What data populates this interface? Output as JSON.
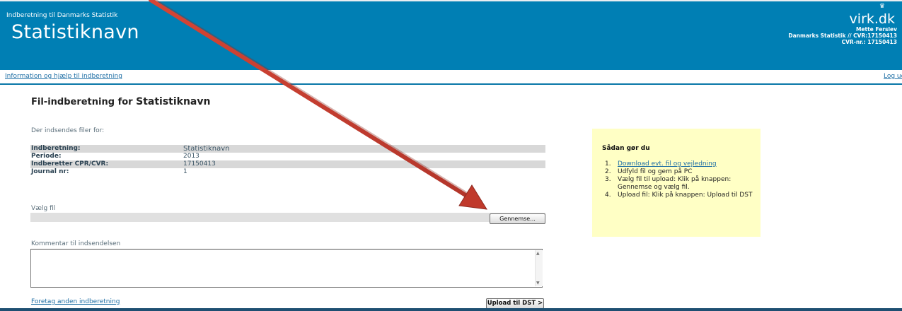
{
  "header": {
    "subtitle": "Indberetning til Danmarks Statistik",
    "title": "Statistiknavn",
    "logo": "virk.dk",
    "user_name": "Mette Ferslev",
    "user_org": "Danmarks Statistik // CVR:17150413",
    "user_cvr": "CVR-nr.: 17150413"
  },
  "nav": {
    "help_link": "Information og hjælp til indberetning",
    "logout_link": "Log ud"
  },
  "page": {
    "title_prefix": "Fil-indberetning for",
    "title_name": "Statistiknavn",
    "intro": "Der indsendes filer for:"
  },
  "info_rows": [
    {
      "label": "Indberetning:",
      "value": "Statistiknavn"
    },
    {
      "label": "Periode:",
      "value": "2013"
    },
    {
      "label": "Indberetter CPR/CVR:",
      "value": "17150413"
    },
    {
      "label": "Journal nr:",
      "value": "1"
    }
  ],
  "file": {
    "label": "Vælg fil",
    "browse_button": "Gennemse..."
  },
  "comment": {
    "label": "Kommentar til indsendelsen",
    "value": ""
  },
  "actions": {
    "other_link": "Foretag anden indberetning",
    "upload_button": "Upload til DST >"
  },
  "help": {
    "title": "Sådan gør du",
    "steps": [
      {
        "num": "1.",
        "text": "Download evt. fil og vejledning"
      },
      {
        "num": "2.",
        "text": "Udfyld fil og gem på PC"
      },
      {
        "num": "3.",
        "text": "Vælg fil til upload: Klik på knappen: Gennemse og vælg fil."
      },
      {
        "num": "4.",
        "text": "Upload fil: Klik på knappen: Upload til DST"
      }
    ]
  },
  "colors": {
    "header_blue": "#007fb4",
    "link_blue": "#1f6fa5",
    "help_bg": "#ffffc5",
    "annotation_arrow": "#c0392b"
  }
}
